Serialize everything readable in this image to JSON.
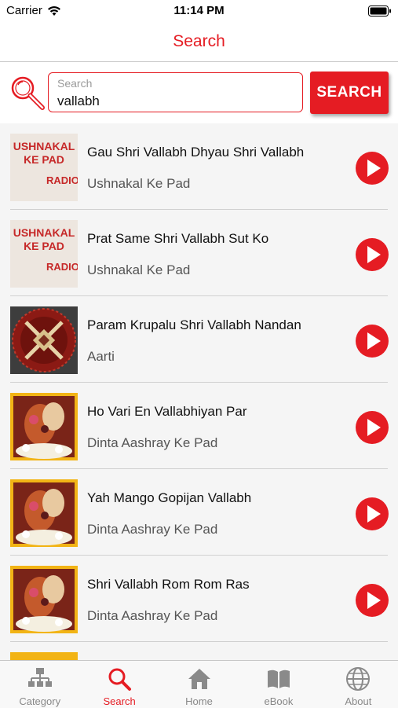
{
  "status_bar": {
    "carrier": "Carrier",
    "time": "11:14 PM"
  },
  "nav": {
    "title": "Search"
  },
  "search": {
    "placeholder": "Search",
    "value": "vallabh",
    "button_label": "SEARCH"
  },
  "thumbnail_texts": {
    "ushnakal_line1": "USHNAKAL",
    "ushnakal_line2": "KE PAD",
    "logo": "RADIO"
  },
  "results": [
    {
      "title": "Gau Shri Vallabh Dhyau Shri Vallabh",
      "album": "Ushnakal Ke Pad"
    },
    {
      "title": "Prat Same Shri Vallabh Sut Ko",
      "album": "Ushnakal Ke Pad"
    },
    {
      "title": "Param Krupalu Shri Vallabh Nandan",
      "album": "Aarti"
    },
    {
      "title": "Ho Vari En Vallabhiyan Par",
      "album": "Dinta Aashray Ke Pad"
    },
    {
      "title": "Yah Mango Gopijan Vallabh",
      "album": "Dinta Aashray Ke Pad"
    },
    {
      "title": "Shri Vallabh Rom Rom Ras",
      "album": "Dinta Aashray Ke Pad"
    }
  ],
  "tabs": [
    {
      "label": "Category",
      "icon": "category-icon",
      "active": false
    },
    {
      "label": "Search",
      "icon": "search-icon",
      "active": true
    },
    {
      "label": "Home",
      "icon": "home-icon",
      "active": false
    },
    {
      "label": "eBook",
      "icon": "ebook-icon",
      "active": false
    },
    {
      "label": "About",
      "icon": "globe-icon",
      "active": false
    }
  ],
  "colors": {
    "accent": "#e51c23",
    "inactive_tab": "#888888"
  }
}
